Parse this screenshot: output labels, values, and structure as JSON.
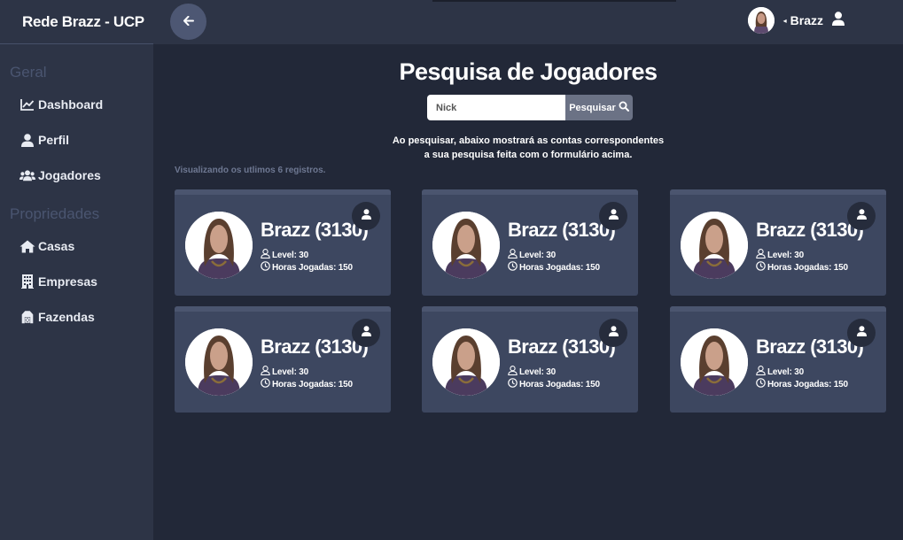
{
  "app": {
    "brand": "Rede Brazz - UCP"
  },
  "sidebar": {
    "section_general": "Geral",
    "section_properties": "Propriedades",
    "items": [
      {
        "label": "Dashboard",
        "icon": "chart-line-icon"
      },
      {
        "label": "Perfil",
        "icon": "user-icon"
      },
      {
        "label": "Jogadores",
        "icon": "users-icon"
      },
      {
        "label": "Casas",
        "icon": "house-icon"
      },
      {
        "label": "Empresas",
        "icon": "building-icon"
      },
      {
        "label": "Fazendas",
        "icon": "barn-icon"
      }
    ]
  },
  "topbar": {
    "user_name": "Brazz",
    "caret": "◂"
  },
  "main": {
    "title": "Pesquisa de Jogadores",
    "search": {
      "placeholder": "Nick",
      "button_label": "Pesquisar"
    },
    "help_line1": "Ao pesquisar, abaixo mostrará as contas correspondentes",
    "help_line2": "a sua pesquisa feita com o formulário acima.",
    "records_text": "Visualizando os utlimos 6 registros."
  },
  "players": [
    {
      "name": "Brazz (3130)",
      "level": "Level: 30",
      "hours": "Horas Jogadas: 150"
    },
    {
      "name": "Brazz (3130)",
      "level": "Level: 30",
      "hours": "Horas Jogadas: 150"
    },
    {
      "name": "Brazz (3130)",
      "level": "Level: 30",
      "hours": "Horas Jogadas: 150"
    },
    {
      "name": "Brazz (3130)",
      "level": "Level: 30",
      "hours": "Horas Jogadas: 150"
    },
    {
      "name": "Brazz (3130)",
      "level": "Level: 30",
      "hours": "Horas Jogadas: 150"
    },
    {
      "name": "Brazz (3130)",
      "level": "Level: 30",
      "hours": "Horas Jogadas: 150"
    }
  ],
  "colors": {
    "background": "#222838",
    "sidebar": "#2d3446",
    "card": "#3d4760",
    "accent": "#4d5773"
  }
}
